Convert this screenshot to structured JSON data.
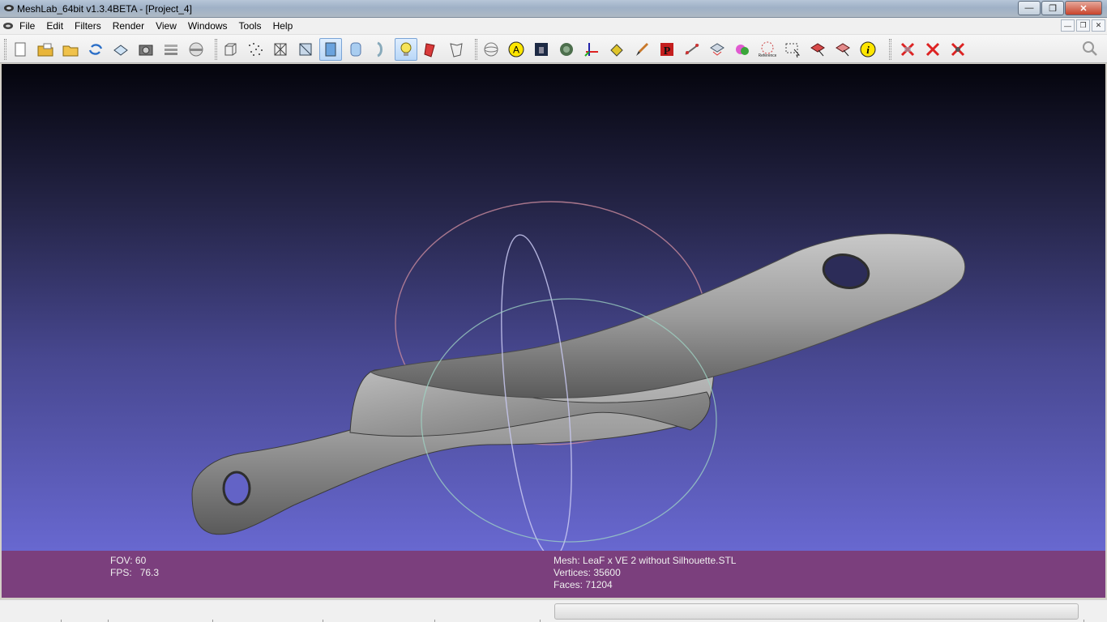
{
  "window": {
    "title": "MeshLab_64bit v1.3.4BETA - [Project_4]",
    "controls": [
      "minimize",
      "maximize",
      "close"
    ]
  },
  "menubar": {
    "items": [
      "File",
      "Edit",
      "Filters",
      "Render",
      "View",
      "Windows",
      "Tools",
      "Help"
    ]
  },
  "toolbar": {
    "groups": [
      [
        "new-project-icon",
        "open-project-icon",
        "open-mesh-icon",
        "reload-icon",
        "save-icon",
        "snapshot-icon",
        "layers-icon",
        "raster-icon"
      ],
      [
        "bbox-icon",
        "points-icon",
        "wireframe-icon",
        "hidden-lines-icon",
        "flat-shading-icon",
        "smooth-shading-icon",
        "texture-icon",
        "light-icon",
        "double-light-icon",
        "back-face-icon"
      ],
      [
        "axis-sphere-icon",
        "annotate-icon",
        "color-icon",
        "pattern-icon",
        "axes-icon",
        "paint-bucket-icon",
        "brush-icon",
        "pickpoints-icon",
        "measure-icon",
        "align-icon",
        "color-paint-icon",
        "reference-icon",
        "select-icon",
        "select-faces-icon",
        "select-vertices-icon",
        "info-icon"
      ],
      [
        "delete-faces-icon",
        "delete-vertices-icon",
        "delete-selected-icon"
      ]
    ],
    "active": [
      "flat-shading-icon",
      "light-icon"
    ],
    "search_icon": "search-icon"
  },
  "info": {
    "fov_label": "FOV:",
    "fov_value": "60",
    "fps_label": "FPS:",
    "fps_value": "76.3",
    "mesh_label": "Mesh:",
    "mesh_name": "LeaF x VE 2 without Silhouette.STL",
    "vertices_label": "Vertices:",
    "vertices_value": "35600",
    "faces_label": "Faces:",
    "faces_value": "71204"
  },
  "status": {
    "progress": 0
  },
  "colors": {
    "info_panel": "#7b3f7d",
    "viewport_top": "#04040c",
    "viewport_bottom": "#6868d0",
    "mesh": "#9c9c9c"
  }
}
